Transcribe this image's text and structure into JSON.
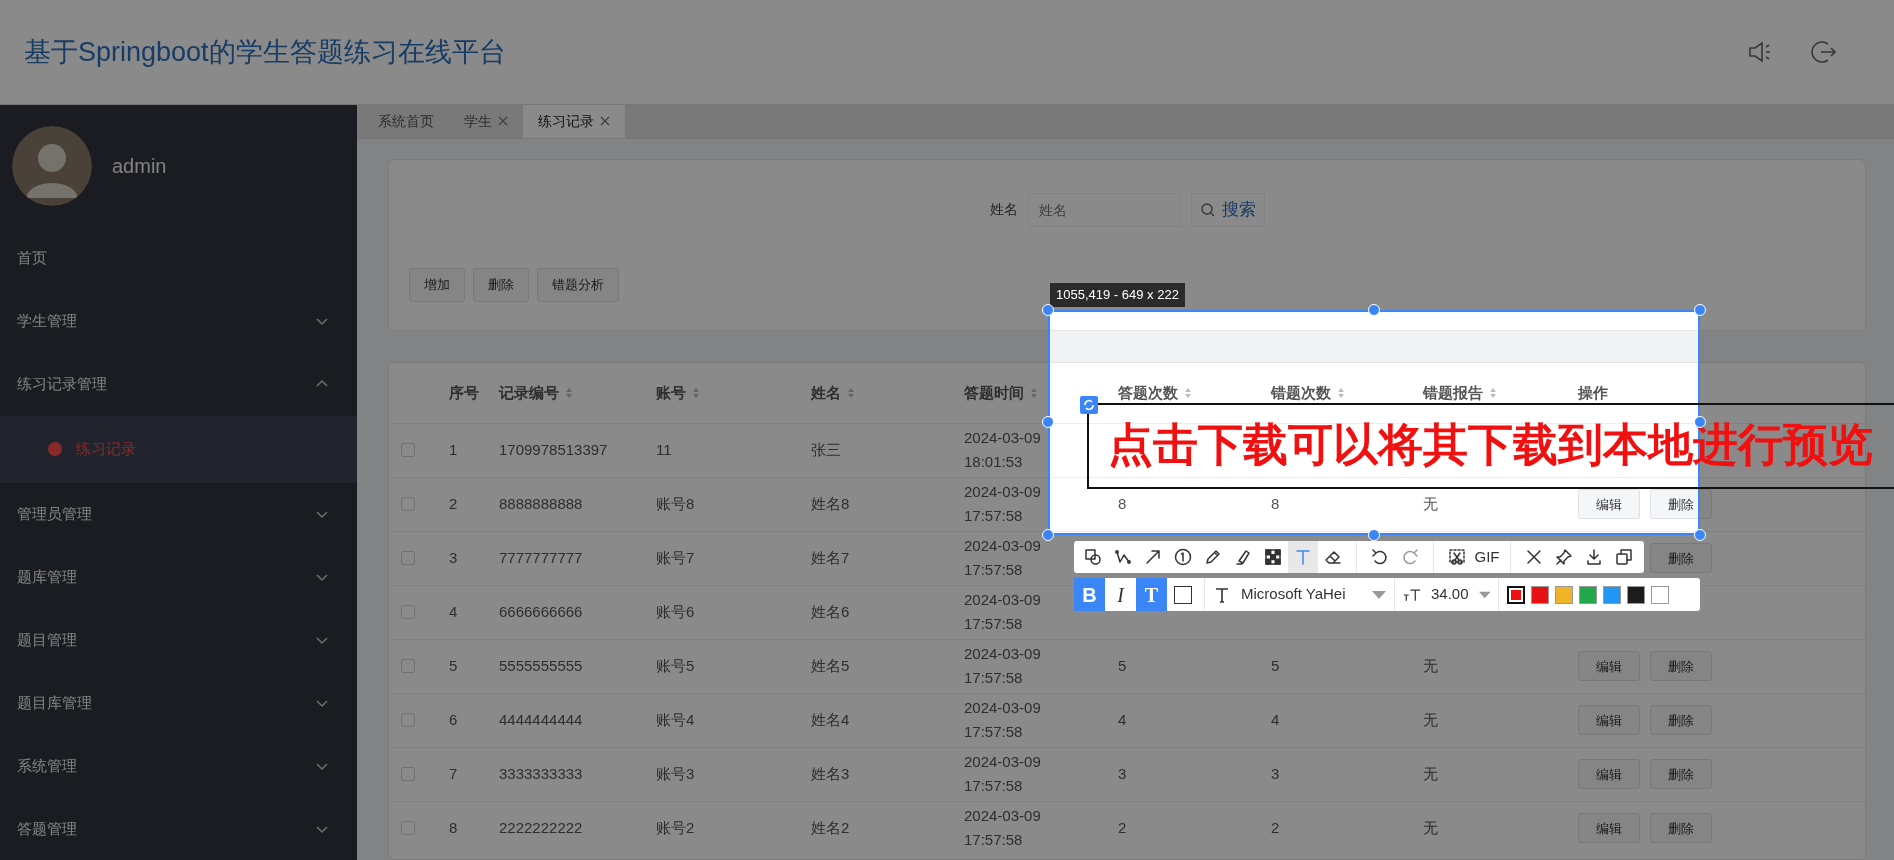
{
  "header": {
    "title": "基于Springboot的学生答题练习在线平台"
  },
  "user": {
    "name": "admin"
  },
  "sidebar": {
    "items": [
      {
        "label": "首页",
        "kind": "link",
        "selected": false
      },
      {
        "label": "学生管理",
        "kind": "group",
        "expanded": false,
        "selected": false
      },
      {
        "label": "练习记录管理",
        "kind": "group",
        "expanded": true,
        "selected": false,
        "children": [
          {
            "label": "练习记录",
            "selected": true
          }
        ]
      },
      {
        "label": "管理员管理",
        "kind": "group",
        "expanded": false,
        "selected": false
      },
      {
        "label": "题库管理",
        "kind": "group",
        "expanded": false,
        "selected": false
      },
      {
        "label": "题目管理",
        "kind": "group",
        "expanded": false,
        "selected": false
      },
      {
        "label": "题目库管理",
        "kind": "group",
        "expanded": false,
        "selected": false
      },
      {
        "label": "系统管理",
        "kind": "group",
        "expanded": false,
        "selected": false
      },
      {
        "label": "答题管理",
        "kind": "group",
        "expanded": false,
        "selected": false
      }
    ]
  },
  "tabs": [
    {
      "label": "系统首页",
      "closable": false,
      "selected": false
    },
    {
      "label": "学生",
      "closable": true,
      "selected": false
    },
    {
      "label": "练习记录",
      "closable": true,
      "selected": true
    }
  ],
  "search": {
    "label": "姓名",
    "placeholder": "姓名",
    "button": "搜索"
  },
  "actions": [
    "增加",
    "删除",
    "错题分析"
  ],
  "table": {
    "columns": [
      {
        "label": "序号",
        "sortable": false
      },
      {
        "label": "记录编号",
        "sortable": true
      },
      {
        "label": "账号",
        "sortable": true
      },
      {
        "label": "姓名",
        "sortable": true
      },
      {
        "label": "答题时间",
        "sortable": true
      },
      {
        "label": "答题次数",
        "sortable": true
      },
      {
        "label": "错题次数",
        "sortable": true
      },
      {
        "label": "错题报告",
        "sortable": true
      },
      {
        "label": "操作",
        "sortable": false
      }
    ],
    "rows": [
      {
        "checked": false,
        "cells": [
          "1",
          "1709978513397",
          "11",
          "张三",
          "2024-03-09 18:01:53"
        ],
        "actions": []
      },
      {
        "checked": false,
        "cells": [
          "2",
          "8888888888",
          "账号8",
          "姓名8",
          "2024-03-09 17:57:58",
          "8",
          "8",
          "无"
        ],
        "actions": [
          {
            "label": "编辑",
            "kind": "edit"
          },
          {
            "label": "删除",
            "kind": "delete"
          }
        ]
      },
      {
        "checked": false,
        "cells": [
          "3",
          "7777777777",
          "账号7",
          "姓名7",
          "2024-03-09 17:57:58"
        ],
        "actions": [
          {
            "label": "删除",
            "kind": "delete"
          }
        ]
      },
      {
        "checked": false,
        "cells": [
          "4",
          "6666666666",
          "账号6",
          "姓名6",
          "2024-03-09 17:57:58"
        ],
        "actions": []
      },
      {
        "checked": false,
        "cells": [
          "5",
          "5555555555",
          "账号5",
          "姓名5",
          "2024-03-09 17:57:58",
          "5",
          "5",
          "无"
        ],
        "actions": [
          {
            "label": "编辑",
            "kind": "edit"
          },
          {
            "label": "删除",
            "kind": "delete"
          }
        ]
      },
      {
        "checked": false,
        "cells": [
          "6",
          "4444444444",
          "账号4",
          "姓名4",
          "2024-03-09 17:57:58",
          "4",
          "4",
          "无"
        ],
        "actions": [
          {
            "label": "编辑",
            "kind": "edit"
          },
          {
            "label": "删除",
            "kind": "delete"
          }
        ]
      },
      {
        "checked": false,
        "cells": [
          "7",
          "3333333333",
          "账号3",
          "姓名3",
          "2024-03-09 17:57:58",
          "3",
          "3",
          "无"
        ],
        "actions": [
          {
            "label": "编辑",
            "kind": "edit"
          },
          {
            "label": "删除",
            "kind": "delete"
          }
        ]
      },
      {
        "checked": false,
        "cells": [
          "8",
          "2222222222",
          "账号2",
          "姓名2",
          "2024-03-09 17:57:58",
          "2",
          "2",
          "无"
        ],
        "actions": [
          {
            "label": "编辑",
            "kind": "edit"
          },
          {
            "label": "删除",
            "kind": "delete"
          }
        ]
      }
    ]
  },
  "capture": {
    "size_label": "1055,419 - 649 x 222",
    "annotation": "点击下载可以将其下载到本地进行预览",
    "tool_groups": [
      [
        {
          "kind": "shape",
          "selected": false
        },
        {
          "kind": "polyline",
          "selected": false
        },
        {
          "kind": "arrow",
          "selected": false
        },
        {
          "kind": "number",
          "selected": false
        },
        {
          "kind": "pencil",
          "selected": false
        },
        {
          "kind": "marker",
          "selected": false
        },
        {
          "kind": "mosaic",
          "selected": false
        },
        {
          "kind": "text",
          "selected": true
        },
        {
          "kind": "eraser",
          "selected": false
        }
      ],
      [
        {
          "kind": "undo",
          "selected": false
        },
        {
          "kind": "redo",
          "selected": false
        }
      ],
      [
        {
          "kind": "cut",
          "selected": false
        },
        {
          "kind": "gif",
          "label": "GIF",
          "selected": false
        }
      ],
      [
        {
          "kind": "close",
          "selected": false
        },
        {
          "kind": "pin",
          "selected": false
        },
        {
          "kind": "download",
          "selected": false
        },
        {
          "kind": "copy",
          "selected": false
        }
      ]
    ],
    "format_buttons": [
      {
        "kind": "bold",
        "label": "B",
        "selected": true
      },
      {
        "kind": "italic",
        "label": "I",
        "selected": false
      },
      {
        "kind": "outline",
        "label": "T",
        "selected": true
      },
      {
        "kind": "fill",
        "selected": false
      }
    ],
    "font": "Microsoft YaHei",
    "size": "34.00",
    "colors": [
      {
        "color": "#ee1111",
        "selected": true
      },
      {
        "color": "#e81212",
        "selected": false
      },
      {
        "color": "#f0b429",
        "selected": false
      },
      {
        "color": "#22a84a",
        "selected": false
      },
      {
        "color": "#2196f3",
        "selected": false
      },
      {
        "color": "#1c1c1c",
        "selected": false
      },
      {
        "color": "#ffffff",
        "selected": false
      }
    ]
  }
}
